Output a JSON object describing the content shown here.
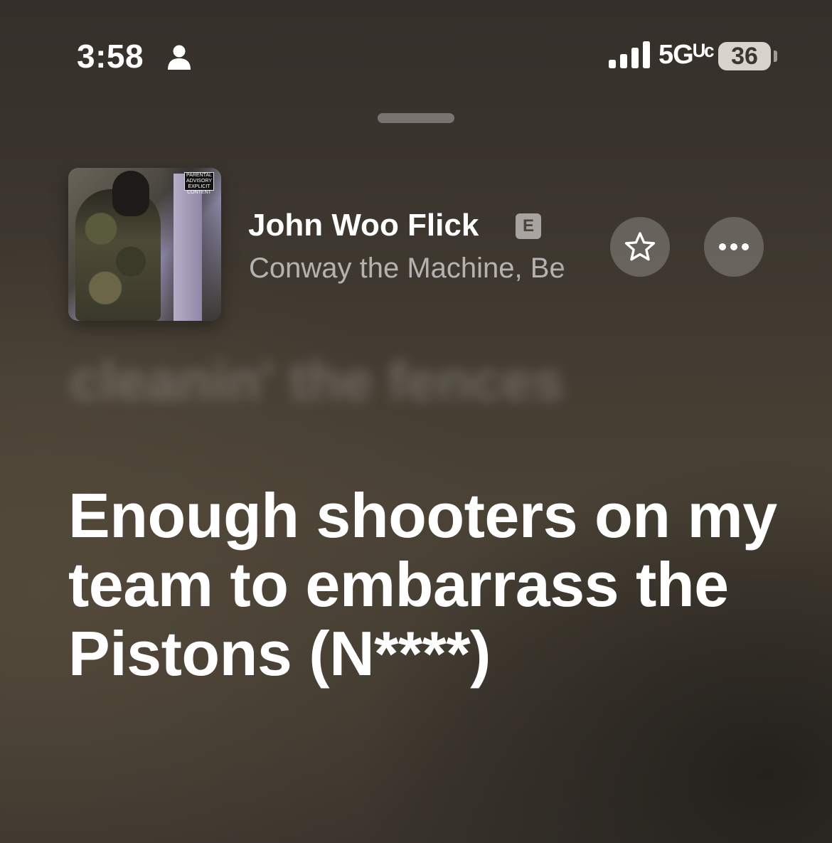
{
  "status_bar": {
    "time": "3:58",
    "network": "5G UC",
    "network_display": "5Gᵁᶜ",
    "battery": "36",
    "icons": [
      "person-icon",
      "signal-icon",
      "battery-icon"
    ]
  },
  "now_playing": {
    "title": "John Woo Flick",
    "explicit_badge": "E",
    "artist": "Conway the Machine, Be",
    "album_art_advisory": "PARENTAL ADVISORY EXPLICIT CONTENT",
    "favorite_icon": "star-icon",
    "more_icon": "ellipsis-icon"
  },
  "lyrics": {
    "previous_line": "cleanin' the fences",
    "current_line": "Enough shooters on my team to embarrass the Pistons (N****)"
  },
  "colors": {
    "background": "#3f3930",
    "text": "#ffffff",
    "secondary_text": "#a29d94",
    "button_fill": "#5a544c"
  }
}
